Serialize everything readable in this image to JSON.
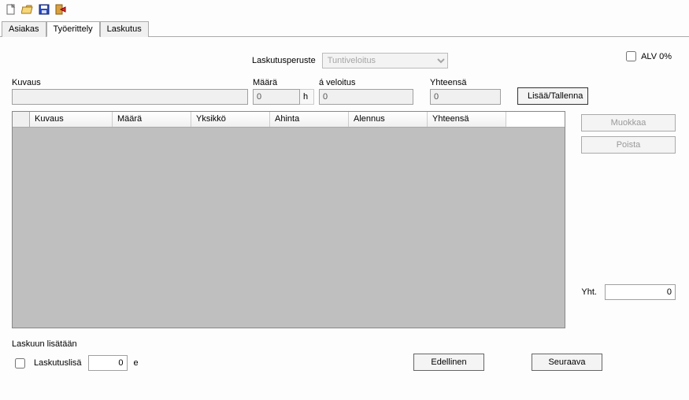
{
  "tabs": {
    "asiakas": "Asiakas",
    "tyoerittely": "Työerittely",
    "laskutus": "Laskutus"
  },
  "billing": {
    "label": "Laskutusperuste",
    "value": "Tuntiveloitus"
  },
  "vat": {
    "label": "ALV 0%",
    "checked": false
  },
  "fields": {
    "kuvaus": {
      "label": "Kuvaus",
      "value": ""
    },
    "maara": {
      "label": "Määrä",
      "value": "0",
      "unit": "h"
    },
    "aveloitus": {
      "label": "á veloitus",
      "value": "0"
    },
    "yhteensa": {
      "label": "Yhteensä",
      "value": "0"
    }
  },
  "add_btn": "Lisää/Tallenna",
  "edit_btn": "Muokkaa",
  "delete_btn": "Poista",
  "grid": {
    "cols": {
      "kuvaus": "Kuvaus",
      "maara": "Määrä",
      "yksikko": "Yksikkö",
      "ahinta": "Ahinta",
      "alennus": "Alennus",
      "yhteensa": "Yhteensä"
    }
  },
  "yht": {
    "label": "Yht.",
    "value": "0"
  },
  "laskuun": {
    "title": "Laskuun lisätään",
    "laskutuslisa_label": "Laskutuslisä",
    "laskutuslisa_value": "0",
    "laskutuslisa_unit": "e"
  },
  "nav": {
    "prev": "Edellinen",
    "next": "Seuraava"
  }
}
